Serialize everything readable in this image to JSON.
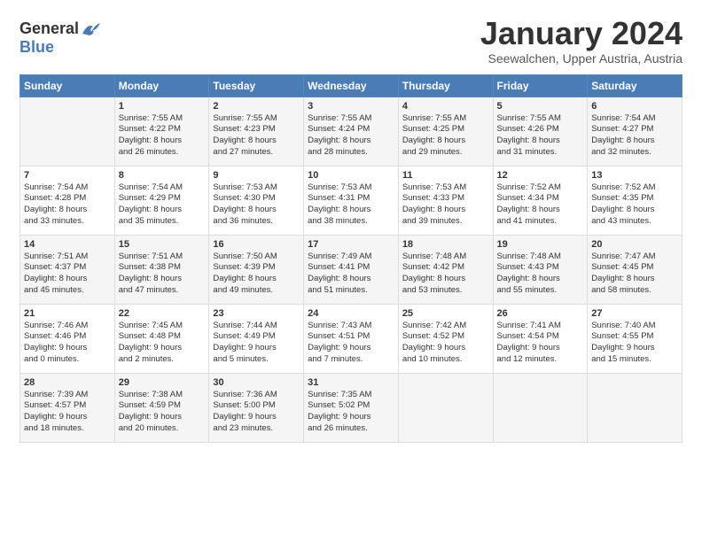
{
  "logo": {
    "general": "General",
    "blue": "Blue"
  },
  "header": {
    "month": "January 2024",
    "location": "Seewalchen, Upper Austria, Austria"
  },
  "weekdays": [
    "Sunday",
    "Monday",
    "Tuesday",
    "Wednesday",
    "Thursday",
    "Friday",
    "Saturday"
  ],
  "weeks": [
    [
      {
        "day": "",
        "content": ""
      },
      {
        "day": "1",
        "content": "Sunrise: 7:55 AM\nSunset: 4:22 PM\nDaylight: 8 hours\nand 26 minutes."
      },
      {
        "day": "2",
        "content": "Sunrise: 7:55 AM\nSunset: 4:23 PM\nDaylight: 8 hours\nand 27 minutes."
      },
      {
        "day": "3",
        "content": "Sunrise: 7:55 AM\nSunset: 4:24 PM\nDaylight: 8 hours\nand 28 minutes."
      },
      {
        "day": "4",
        "content": "Sunrise: 7:55 AM\nSunset: 4:25 PM\nDaylight: 8 hours\nand 29 minutes."
      },
      {
        "day": "5",
        "content": "Sunrise: 7:55 AM\nSunset: 4:26 PM\nDaylight: 8 hours\nand 31 minutes."
      },
      {
        "day": "6",
        "content": "Sunrise: 7:54 AM\nSunset: 4:27 PM\nDaylight: 8 hours\nand 32 minutes."
      }
    ],
    [
      {
        "day": "7",
        "content": "Sunrise: 7:54 AM\nSunset: 4:28 PM\nDaylight: 8 hours\nand 33 minutes."
      },
      {
        "day": "8",
        "content": "Sunrise: 7:54 AM\nSunset: 4:29 PM\nDaylight: 8 hours\nand 35 minutes."
      },
      {
        "day": "9",
        "content": "Sunrise: 7:53 AM\nSunset: 4:30 PM\nDaylight: 8 hours\nand 36 minutes."
      },
      {
        "day": "10",
        "content": "Sunrise: 7:53 AM\nSunset: 4:31 PM\nDaylight: 8 hours\nand 38 minutes."
      },
      {
        "day": "11",
        "content": "Sunrise: 7:53 AM\nSunset: 4:33 PM\nDaylight: 8 hours\nand 39 minutes."
      },
      {
        "day": "12",
        "content": "Sunrise: 7:52 AM\nSunset: 4:34 PM\nDaylight: 8 hours\nand 41 minutes."
      },
      {
        "day": "13",
        "content": "Sunrise: 7:52 AM\nSunset: 4:35 PM\nDaylight: 8 hours\nand 43 minutes."
      }
    ],
    [
      {
        "day": "14",
        "content": "Sunrise: 7:51 AM\nSunset: 4:37 PM\nDaylight: 8 hours\nand 45 minutes."
      },
      {
        "day": "15",
        "content": "Sunrise: 7:51 AM\nSunset: 4:38 PM\nDaylight: 8 hours\nand 47 minutes."
      },
      {
        "day": "16",
        "content": "Sunrise: 7:50 AM\nSunset: 4:39 PM\nDaylight: 8 hours\nand 49 minutes."
      },
      {
        "day": "17",
        "content": "Sunrise: 7:49 AM\nSunset: 4:41 PM\nDaylight: 8 hours\nand 51 minutes."
      },
      {
        "day": "18",
        "content": "Sunrise: 7:48 AM\nSunset: 4:42 PM\nDaylight: 8 hours\nand 53 minutes."
      },
      {
        "day": "19",
        "content": "Sunrise: 7:48 AM\nSunset: 4:43 PM\nDaylight: 8 hours\nand 55 minutes."
      },
      {
        "day": "20",
        "content": "Sunrise: 7:47 AM\nSunset: 4:45 PM\nDaylight: 8 hours\nand 58 minutes."
      }
    ],
    [
      {
        "day": "21",
        "content": "Sunrise: 7:46 AM\nSunset: 4:46 PM\nDaylight: 9 hours\nand 0 minutes."
      },
      {
        "day": "22",
        "content": "Sunrise: 7:45 AM\nSunset: 4:48 PM\nDaylight: 9 hours\nand 2 minutes."
      },
      {
        "day": "23",
        "content": "Sunrise: 7:44 AM\nSunset: 4:49 PM\nDaylight: 9 hours\nand 5 minutes."
      },
      {
        "day": "24",
        "content": "Sunrise: 7:43 AM\nSunset: 4:51 PM\nDaylight: 9 hours\nand 7 minutes."
      },
      {
        "day": "25",
        "content": "Sunrise: 7:42 AM\nSunset: 4:52 PM\nDaylight: 9 hours\nand 10 minutes."
      },
      {
        "day": "26",
        "content": "Sunrise: 7:41 AM\nSunset: 4:54 PM\nDaylight: 9 hours\nand 12 minutes."
      },
      {
        "day": "27",
        "content": "Sunrise: 7:40 AM\nSunset: 4:55 PM\nDaylight: 9 hours\nand 15 minutes."
      }
    ],
    [
      {
        "day": "28",
        "content": "Sunrise: 7:39 AM\nSunset: 4:57 PM\nDaylight: 9 hours\nand 18 minutes."
      },
      {
        "day": "29",
        "content": "Sunrise: 7:38 AM\nSunset: 4:59 PM\nDaylight: 9 hours\nand 20 minutes."
      },
      {
        "day": "30",
        "content": "Sunrise: 7:36 AM\nSunset: 5:00 PM\nDaylight: 9 hours\nand 23 minutes."
      },
      {
        "day": "31",
        "content": "Sunrise: 7:35 AM\nSunset: 5:02 PM\nDaylight: 9 hours\nand 26 minutes."
      },
      {
        "day": "",
        "content": ""
      },
      {
        "day": "",
        "content": ""
      },
      {
        "day": "",
        "content": ""
      }
    ]
  ]
}
